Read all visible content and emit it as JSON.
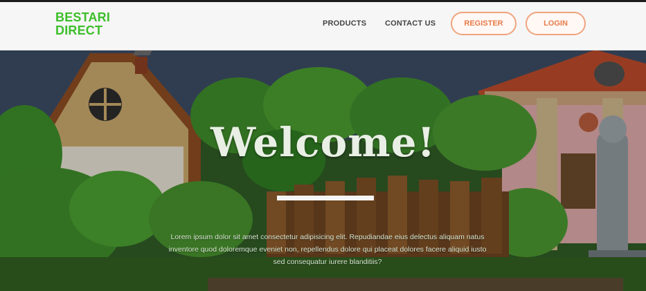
{
  "brand": {
    "line1": "BESTARI",
    "line2": "DIRECT",
    "color": "#3cbf2a"
  },
  "nav": {
    "products": "PRODUCTS",
    "contact": "CONTACT US",
    "register": "REGISTER",
    "login": "LOGIN",
    "accent": "#e77b4a"
  },
  "hero": {
    "title": "Welcome!",
    "description": "Lorem ipsum dolor sit amet consectetur adipisicing elit. Repudiandae eius delectus aliquam natus inventore quod doloremque eveniet non, repellendus dolore qui placeat dolores facere aliquid iusto sed consequatur iurere blanditiis?",
    "background": "cartoon village illustration"
  }
}
